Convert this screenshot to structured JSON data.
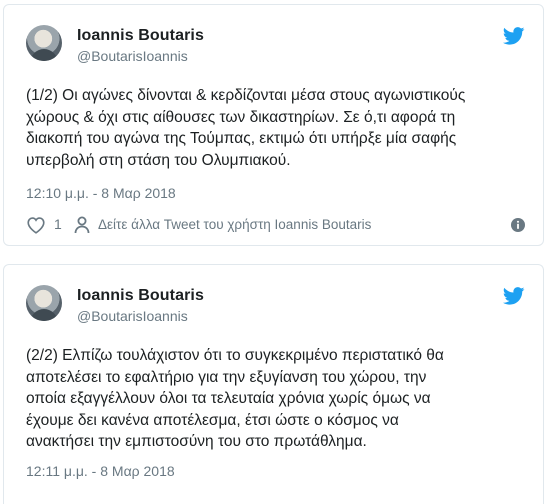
{
  "tweets": [
    {
      "author": "Ioannis Boutaris",
      "handle": "@BoutarisIoannis",
      "text": "(1/2) Οι αγώνες δίνονται & κερδίζονται μέσα στους αγωνιστικούς\nχώρους & όχι στις αίθουσες των δικαστηρίων. Σε ό,τι αφορά τη\nδιακοπή του αγώνα της Τούμπας, εκτιμώ ότι υπήρξε μία σαφής\nυπερβολή στη στάση του Ολυμπιακού.",
      "timestamp": "12:10 μ.μ. - 8 Μαρ 2018",
      "like_count": "1",
      "more_link": "Δείτε άλλα Tweet του χρήστη Ioannis Boutaris"
    },
    {
      "author": "Ioannis Boutaris",
      "handle": "@BoutarisIoannis",
      "text": "(2/2) Ελπίζω τουλάχιστον ότι το συγκεκριμένο περιστατικό θα\nαποτελέσει το εφαλτήριο για την εξυγίανση του χώρου, την\nοποία εξαγγέλλουν όλοι τα τελευταία χρόνια χωρίς όμως να\nέχουμε δει κανένα αποτέλεσμα, έτσι ώστε ο κόσμος να\nανακτήσει την εμπιστοσύνη του στο πρωτάθλημα.",
      "timestamp": "12:11 μ.μ. - 8 Μαρ 2018"
    }
  ],
  "colors": {
    "twitter_blue": "#1da1f2",
    "muted": "#697882",
    "border": "#e1e8ed"
  },
  "icons": {
    "brand": "twitter-bird-icon",
    "like": "heart-icon",
    "profile": "person-icon",
    "info": "info-icon"
  }
}
